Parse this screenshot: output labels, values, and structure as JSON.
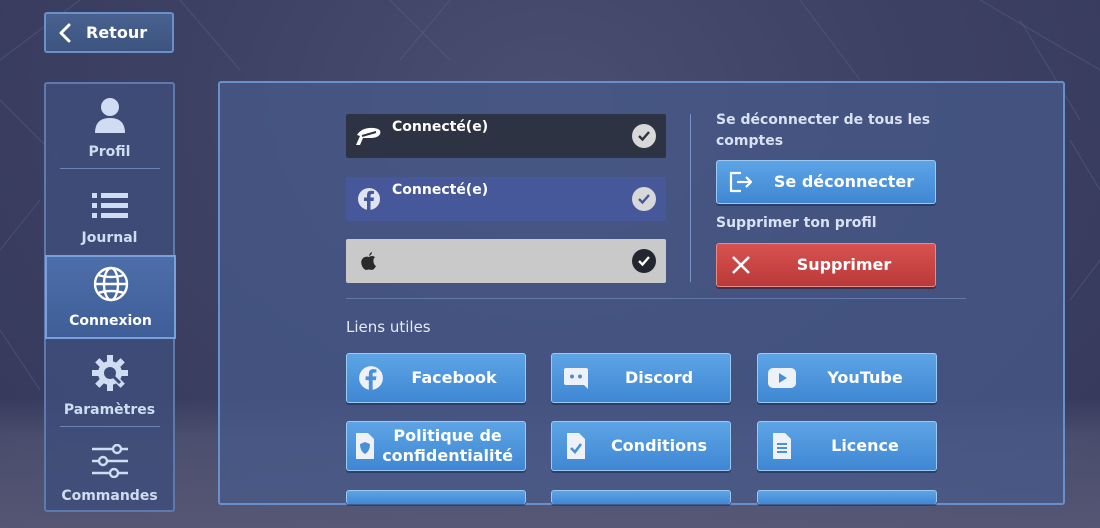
{
  "header": {
    "back_label": "Retour"
  },
  "sidebar": {
    "items": [
      {
        "label": "Profil",
        "icon": "user-icon",
        "active": false
      },
      {
        "label": "Journal",
        "icon": "list-icon",
        "active": false
      },
      {
        "label": "Connexion",
        "icon": "globe-icon",
        "active": true
      },
      {
        "label": "Paramètres",
        "icon": "gear-icon",
        "active": false
      },
      {
        "label": "Commandes",
        "icon": "sliders-icon",
        "active": false
      }
    ]
  },
  "accounts": [
    {
      "provider_icon": "psn-icon",
      "status": "Connecté(e)",
      "checked": true,
      "bg": "#2e3344"
    },
    {
      "provider_icon": "facebook-icon",
      "status": "Connecté(e)",
      "checked": true,
      "bg": "#47589a"
    },
    {
      "provider_icon": "apple-icon",
      "status": "",
      "checked": true,
      "bg": "#c9c9c9"
    }
  ],
  "logout": {
    "heading": "Se déconnecter de tous les comptes",
    "button_label": "Se déconnecter"
  },
  "delete": {
    "heading": "Supprimer ton profil",
    "button_label": "Supprimer"
  },
  "links": {
    "heading": "Liens utiles",
    "items": [
      {
        "label": "Facebook",
        "icon": "facebook-icon"
      },
      {
        "label": "Discord",
        "icon": "discord-icon"
      },
      {
        "label": "YouTube",
        "icon": "youtube-icon"
      },
      {
        "label": "Politique de confidentialité",
        "icon": "shield-document-icon"
      },
      {
        "label": "Conditions",
        "icon": "document-check-icon"
      },
      {
        "label": "Licence",
        "icon": "document-icon"
      }
    ]
  },
  "colors": {
    "accent_blue": "#4a93dc",
    "danger_red": "#c94444",
    "panel": "#465a8a"
  }
}
